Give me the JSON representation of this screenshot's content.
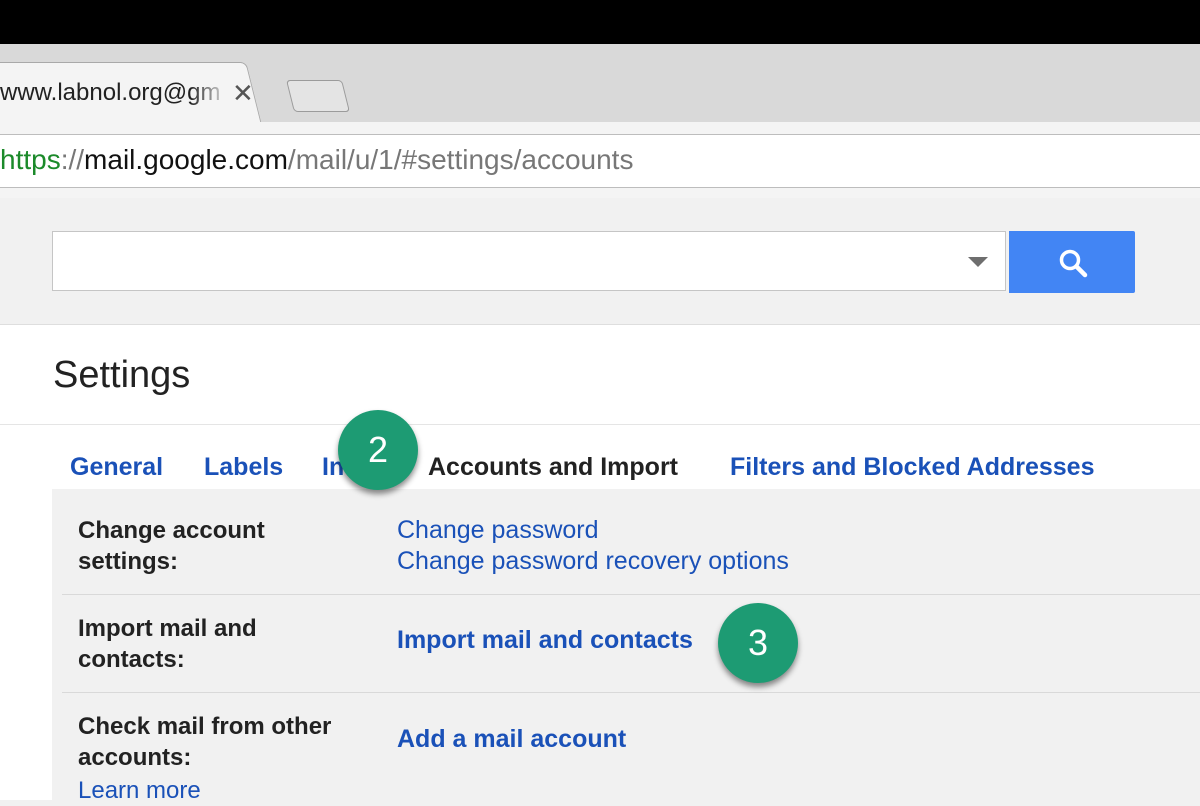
{
  "browser": {
    "tab_title": "www.labnol.org@gm",
    "tab_close_glyph": "✕",
    "address": {
      "scheme": "https",
      "separator": "://",
      "host": "mail.google.com",
      "path": "/mail/u/1/#settings/accounts"
    }
  },
  "search": {
    "value": "",
    "placeholder": "",
    "button_icon": "search-icon",
    "button_color": "#4285f4"
  },
  "settings": {
    "title": "Settings",
    "tabs": {
      "general": "General",
      "labels": "Labels",
      "inbox_partial": "In",
      "accounts": "Accounts and Import",
      "filters": "Filters and Blocked Addresses"
    },
    "rows": {
      "change_account": {
        "label": "Change account settings:",
        "links": [
          "Change password",
          "Change password recovery options"
        ]
      },
      "import_mail": {
        "label": "Import mail and contacts:",
        "link": "Import mail and contacts"
      },
      "check_mail": {
        "label": "Check mail from other accounts:",
        "link": "Add a mail account",
        "learn_more": "Learn more"
      }
    }
  },
  "annotations": {
    "marker_2": "2",
    "marker_3": "3",
    "marker_color": "#1d9b73"
  },
  "colors": {
    "link": "#1a51b8",
    "https_green": "#1b8a2a"
  }
}
